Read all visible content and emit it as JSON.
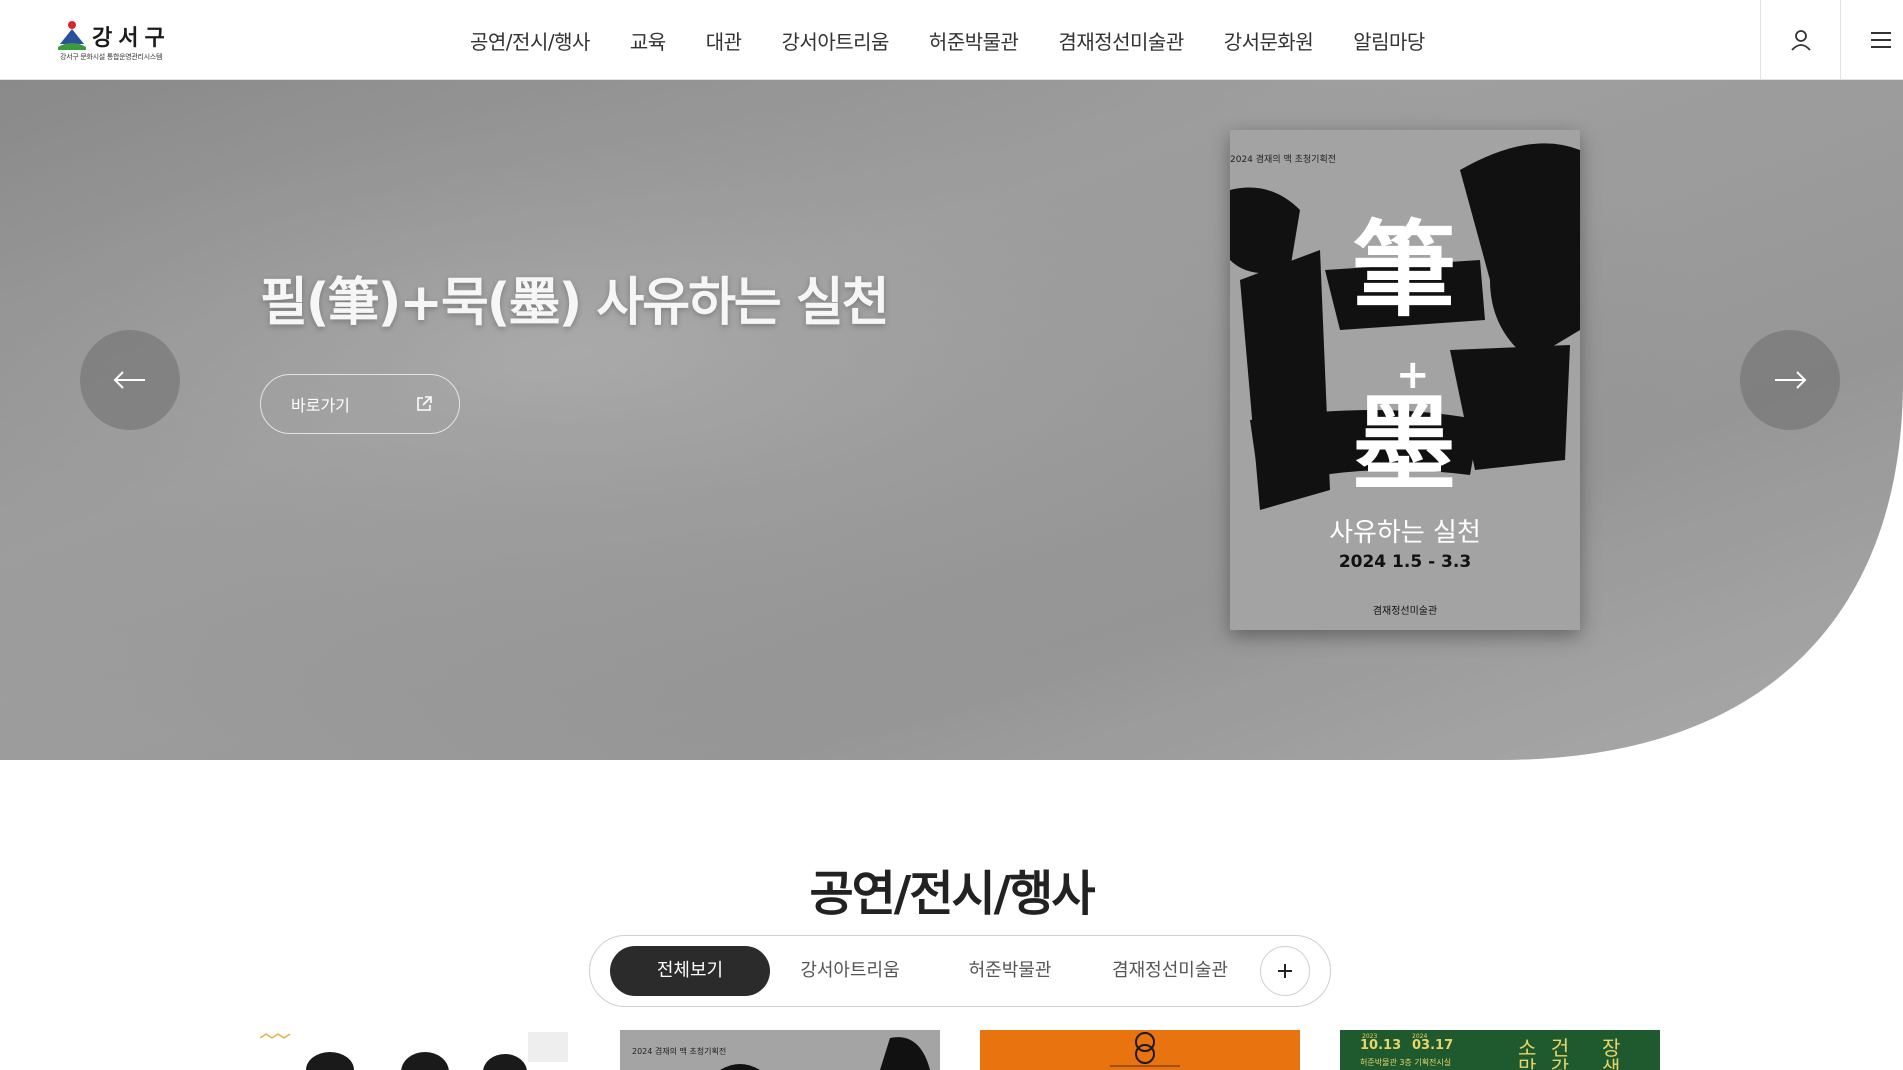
{
  "header": {
    "logo_title": "강서구",
    "logo_subtitle": "강서구 문화시설 통합운영관리시스템",
    "nav": [
      "공연/전시/행사",
      "교육",
      "대관",
      "강서아트리움",
      "허준박물관",
      "겸재정선미술관",
      "강서문화원",
      "알림마당"
    ],
    "user_icon": "user-icon",
    "menu_icon": "hamburger-menu-icon"
  },
  "hero": {
    "title": "필(筆)+묵(墨) 사유하는 실천",
    "link_label": "바로가기",
    "link_icon": "external-link-icon",
    "prev_icon": "arrow-left-icon",
    "next_icon": "arrow-right-icon",
    "poster": {
      "header": "2024 겸재의 맥 초청기획전",
      "char_1": "筆",
      "plus": "+",
      "char_2": "墨",
      "subtitle": "사유하는 실천",
      "date": "2024 1.5 - 3.3",
      "org": "겸재정선미술관"
    }
  },
  "section": {
    "title": "공연/전시/행사",
    "tabs": [
      "전체보기",
      "강서아트리움",
      "허준박물관",
      "겸재정선미술관"
    ],
    "active_tab": "전체보기",
    "more_icon": "plus-icon"
  },
  "thumbs": {
    "t2_header": "2024 겸재의 맥 초청기획전",
    "t4_date_start": "10.13",
    "t4_date_end": "03.17",
    "t4_year_start": "2023",
    "t4_year_end": "2024",
    "t4_place": "허준박물관 3층 기획전시실",
    "t4_title_1": "소 건",
    "t4_title_2": "장",
    "t4_title_3": "망 강",
    "t4_title_4": "생"
  },
  "colors": {
    "accent_dark": "#2b2b2b",
    "hero_gray": "#9a9a9a",
    "thumb_orange": "#e8730f",
    "thumb_green": "#1f5a2e"
  }
}
